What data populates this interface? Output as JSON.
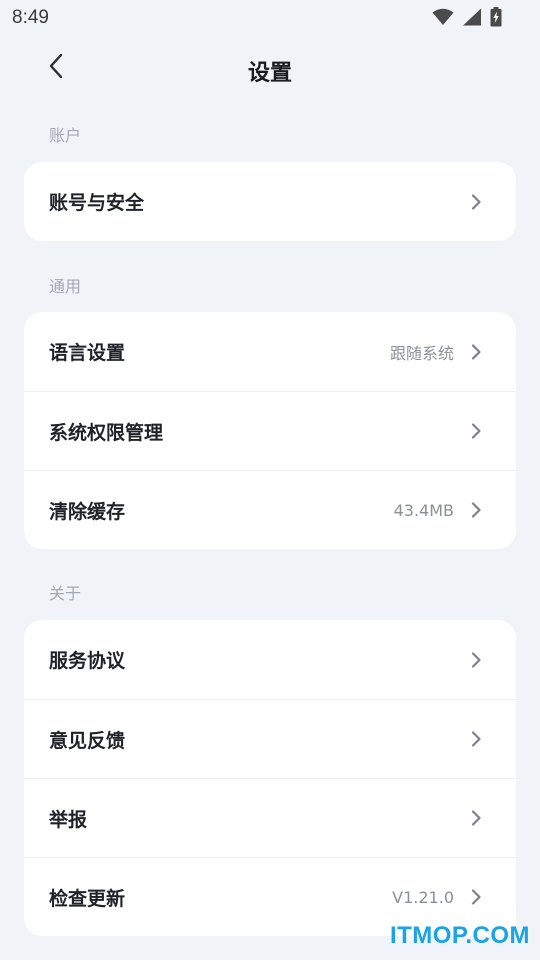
{
  "status_bar": {
    "time": "8:49",
    "icons": [
      "wifi-icon",
      "signal-icon",
      "battery-charging-icon"
    ]
  },
  "header": {
    "back_icon": "chevron-left-icon",
    "title": "设置"
  },
  "sections": [
    {
      "label": "账户",
      "rows": [
        {
          "label": "账号与安全",
          "value": ""
        }
      ]
    },
    {
      "label": "通用",
      "rows": [
        {
          "label": "语言设置",
          "value": "跟随系统"
        },
        {
          "label": "系统权限管理",
          "value": ""
        },
        {
          "label": "清除缓存",
          "value": "43.4MB"
        }
      ]
    },
    {
      "label": "关于",
      "rows": [
        {
          "label": "服务协议",
          "value": ""
        },
        {
          "label": "意见反馈",
          "value": ""
        },
        {
          "label": "举报",
          "value": ""
        },
        {
          "label": "检查更新",
          "value": "V1.21.0"
        }
      ]
    }
  ],
  "watermark": "ITMOP.COM",
  "colors": {
    "background": "#f0f3f8",
    "card": "#ffffff",
    "section_label": "#a4aab3",
    "value_text": "#8b9098",
    "watermark": "#1aa3e6"
  }
}
